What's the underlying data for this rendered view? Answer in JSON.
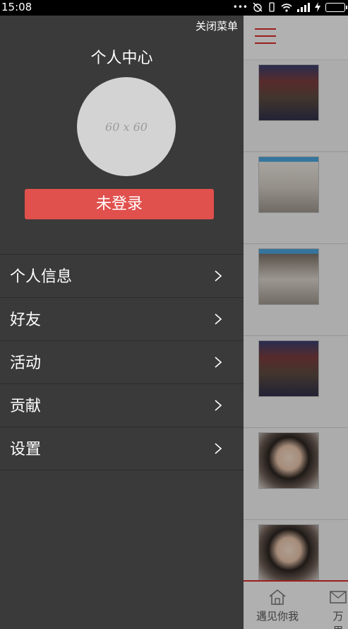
{
  "status_bar": {
    "time": "15:08",
    "icons": [
      "more-dots-icon",
      "alarm-off-icon",
      "vibrate-icon",
      "wifi-icon",
      "signal-icon",
      "charging-icon",
      "battery-icon"
    ]
  },
  "drawer": {
    "close_label": "关闭菜单",
    "title": "个人中心",
    "avatar_placeholder": "60 x 60",
    "login_button": "未登录",
    "menu": [
      {
        "label": "个人信息",
        "icon": "chevron-right-icon"
      },
      {
        "label": "好友",
        "icon": "chevron-right-icon"
      },
      {
        "label": "活动",
        "icon": "chevron-right-icon"
      },
      {
        "label": "贡献",
        "icon": "chevron-right-icon"
      },
      {
        "label": "设置",
        "icon": "chevron-right-icon"
      }
    ]
  },
  "main": {
    "menu_icon": "hamburger-menu-icon",
    "feed": [
      {
        "thumb": "coffee-shop-screenshot"
      },
      {
        "thumb": "cafe-interior-screenshot"
      },
      {
        "thumb": "store-interior-screenshot"
      },
      {
        "thumb": "coffee-shop-screenshot"
      },
      {
        "thumb": "portrait-photo"
      },
      {
        "thumb": "portrait-photo"
      }
    ],
    "bottom_nav": [
      {
        "label": "遇见你我",
        "icon": "home-icon"
      },
      {
        "label": "万里",
        "icon": "mail-icon"
      }
    ]
  },
  "colors": {
    "accent": "#e0504c",
    "drawer_bg": "#3a3a3a",
    "menu_icon": "#d62b2b"
  }
}
